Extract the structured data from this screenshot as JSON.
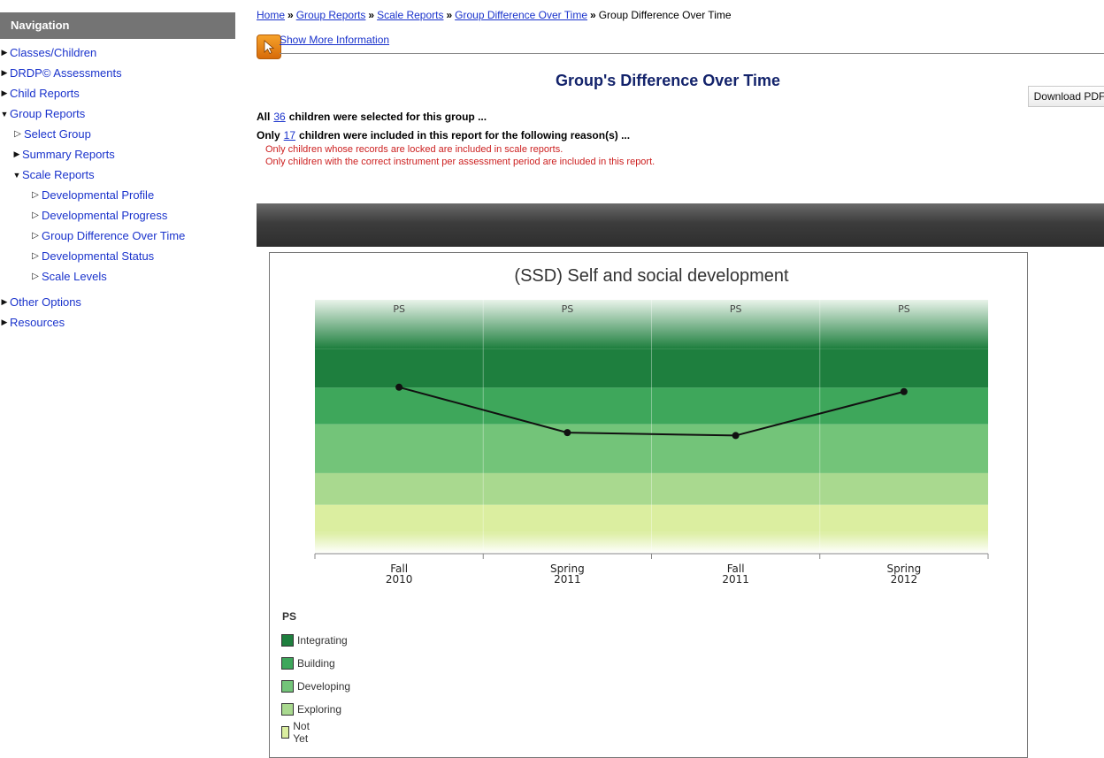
{
  "sidebar": {
    "header": "Navigation",
    "items": [
      {
        "label": "Classes/Children"
      },
      {
        "label": "DRDP© Assessments"
      },
      {
        "label": "Child Reports"
      },
      {
        "label": "Group Reports"
      },
      {
        "label": "Select Group"
      },
      {
        "label": "Summary Reports"
      },
      {
        "label": "Scale Reports"
      },
      {
        "label": "Developmental Profile"
      },
      {
        "label": "Developmental Progress"
      },
      {
        "label": "Group Difference Over Time"
      },
      {
        "label": "Developmental Status"
      },
      {
        "label": "Scale Levels"
      },
      {
        "label": "Other Options"
      },
      {
        "label": "Resources"
      }
    ]
  },
  "breadcrumb": {
    "links": [
      "Home",
      "Group Reports",
      "Scale Reports",
      "Group Difference Over Time"
    ],
    "separator": "»",
    "current": "Group Difference Over Time"
  },
  "info": {
    "show_more": "Show More Information"
  },
  "toolbar": {
    "download_pdf": "Download PDF"
  },
  "page_title": "Group's Difference Over Time",
  "selection": {
    "line1_prefix": "All",
    "line1_count": "36",
    "line1_suffix": "children were selected for this group ...",
    "line2_prefix": "Only",
    "line2_count": "17",
    "line2_suffix": "children were included in this report for the following reason(s) ...",
    "reasons": [
      "Only children whose records are locked are included in scale reports.",
      "Only children with the correct instrument per assessment period are included in this report."
    ]
  },
  "colors": {
    "integrating": "#1e7f3e",
    "building": "#3ea75b",
    "developing": "#73c479",
    "exploring": "#a9d98f",
    "not_yet": "#dbeea0",
    "line": "#111111"
  },
  "chart_data": {
    "type": "line",
    "title": "(SSD) Self and social development",
    "categories": [
      "Fall\n2010",
      "Spring\n2011",
      "Fall\n2011",
      "Spring\n2012"
    ],
    "period_labels": [
      "PS",
      "PS",
      "PS",
      "PS"
    ],
    "bands": [
      "Integrating",
      "Building",
      "Developing",
      "Exploring",
      "Not Yet"
    ],
    "series": [
      {
        "values": [
          4.41,
          3.48,
          3.42,
          4.32
        ]
      }
    ],
    "ylim": [
      1,
      6.2
    ],
    "grid": true,
    "legend": {
      "title": "PS",
      "position": "bottom-left",
      "items": [
        "Integrating",
        "Building",
        "Developing",
        "Exploring",
        "Not Yet"
      ]
    }
  }
}
